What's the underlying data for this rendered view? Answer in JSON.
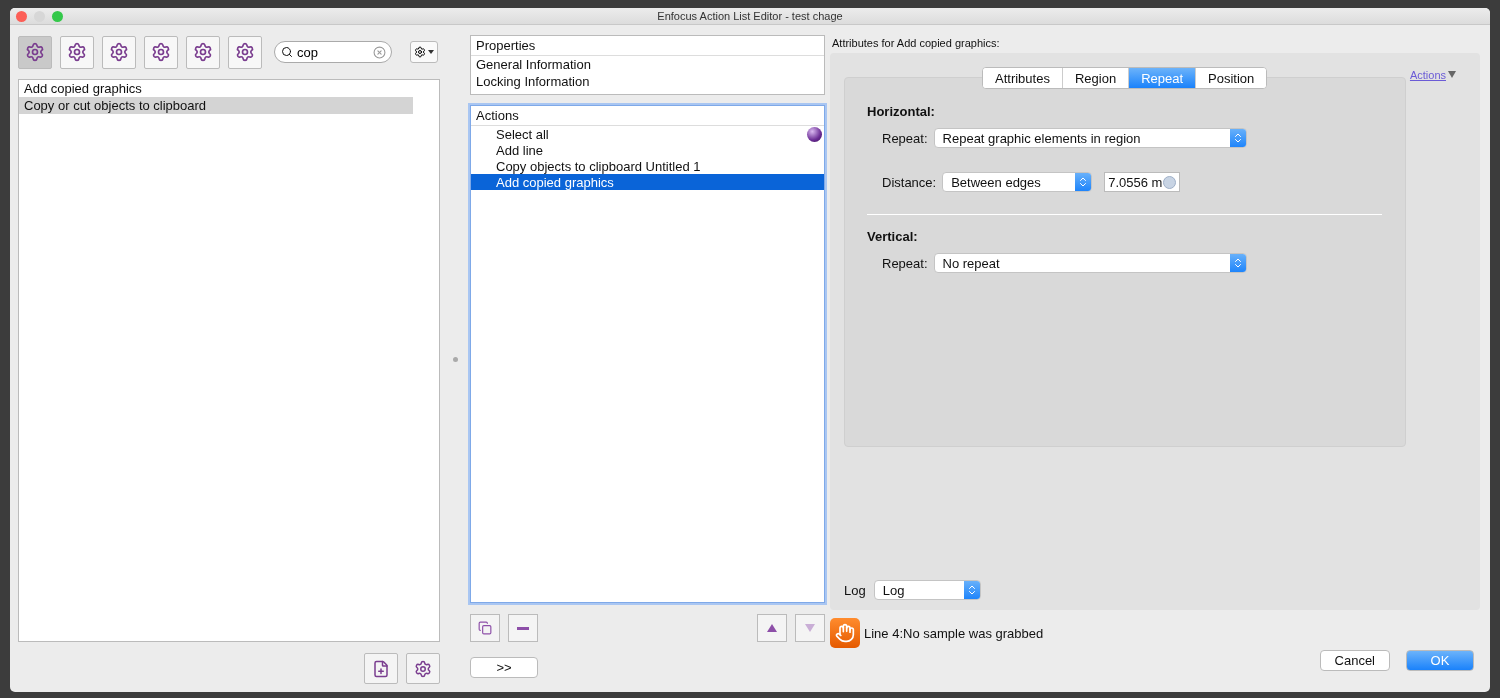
{
  "window": {
    "title": "Enfocus Action List Editor - test chage"
  },
  "toolbar": {
    "tools": [
      {
        "selected": true
      },
      {
        "selected": false
      },
      {
        "selected": false
      },
      {
        "selected": false
      },
      {
        "selected": false
      },
      {
        "selected": false
      }
    ],
    "search": {
      "value": "cop"
    }
  },
  "library": {
    "items": [
      {
        "label": "Add copied graphics",
        "selected": false
      },
      {
        "label": "Copy or cut objects to clipboard",
        "selected": true
      }
    ]
  },
  "properties": {
    "header": "Properties",
    "items": [
      "General Information",
      "Locking Information"
    ]
  },
  "actions": {
    "header": "Actions",
    "items": [
      {
        "label": "Select all",
        "selected": false,
        "flagged": true
      },
      {
        "label": "Add line",
        "selected": false,
        "flagged": false
      },
      {
        "label": "Copy objects to clipboard Untitled 1",
        "selected": false,
        "flagged": false
      },
      {
        "label": "Add copied graphics",
        "selected": true,
        "flagged": false
      }
    ],
    "move_up": {
      "disabled": false
    },
    "move_down": {
      "disabled": true
    },
    "expand_button": ">>"
  },
  "attributes": {
    "heading": "Attributes for Add copied graphics:",
    "actions_link": "Actions",
    "tabs": [
      {
        "label": "Attributes",
        "selected": false
      },
      {
        "label": "Region",
        "selected": false
      },
      {
        "label": "Repeat",
        "selected": true
      },
      {
        "label": "Position",
        "selected": false
      }
    ],
    "horizontal": {
      "heading": "Horizontal:",
      "repeat_label": "Repeat:",
      "repeat_value": "Repeat graphic elements in region",
      "distance_label": "Distance:",
      "distance_value": "Between edges",
      "distance_amount": "7.0556 m"
    },
    "vertical": {
      "heading": "Vertical:",
      "repeat_label": "Repeat:",
      "repeat_value": "No repeat"
    },
    "log": {
      "label": "Log",
      "value": "Log"
    }
  },
  "message": "Line 4:No sample was grabbed",
  "buttons": [
    {
      "label": "Cancel",
      "default": false
    },
    {
      "label": "OK",
      "default": true
    }
  ]
}
